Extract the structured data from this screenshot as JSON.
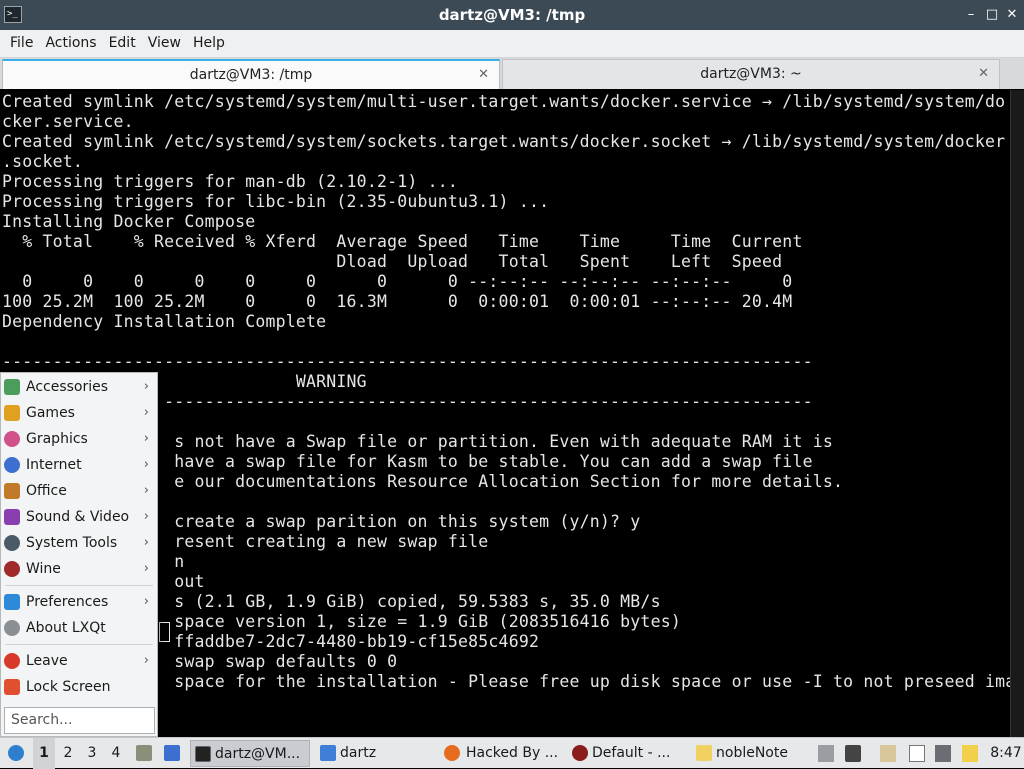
{
  "window": {
    "title": "dartz@VM3: /tmp",
    "app_icon_text": ">_",
    "minimize": "–",
    "maximize": "□",
    "close": "✕"
  },
  "menubar": [
    "File",
    "Actions",
    "Edit",
    "View",
    "Help"
  ],
  "tabs": [
    {
      "label": "dartz@VM3: /tmp",
      "close": "✕"
    },
    {
      "label": "dartz@VM3: ~",
      "close": "✕"
    }
  ],
  "terminal": {
    "lines": [
      "Created symlink /etc/systemd/system/multi-user.target.wants/docker.service → /lib/systemd/system/do",
      "cker.service.",
      "Created symlink /etc/systemd/system/sockets.target.wants/docker.socket → /lib/systemd/system/docker",
      ".socket.",
      "Processing triggers for man-db (2.10.2-1) ...",
      "Processing triggers for libc-bin (2.35-0ubuntu3.1) ...",
      "Installing Docker Compose",
      "  % Total    % Received % Xferd  Average Speed   Time    Time     Time  Current",
      "                                 Dload  Upload   Total   Spent    Left  Speed",
      "  0     0    0     0    0     0      0      0 --:--:-- --:--:-- --:--:--     0",
      "100 25.2M  100 25.2M    0     0  16.3M      0  0:00:01  0:00:01 --:--:-- 20.4M",
      "Dependency Installation Complete",
      "",
      "--------------------------------------------------------------------------------",
      "                             WARNING",
      "                ----------------------------------------------------------------",
      "",
      "                 s not have a Swap file or partition. Even with adequate RAM it is",
      "                 have a swap file for Kasm to be stable. You can add a swap file",
      "                 e our documentations Resource Allocation Section for more details.",
      "",
      "                 create a swap parition on this system (y/n)? y",
      "                 resent creating a new swap file",
      "                 n",
      "                 out",
      "                 s (2.1 GB, 1.9 GiB) copied, 59.5383 s, 35.0 MB/s",
      "                 space version 1, size = 1.9 GiB (2083516416 bytes)",
      "                 ffaddbe7-2dc7-4480-bb19-cf15e85c4692",
      "                 swap swap defaults 0 0",
      "                 space for the installation - Please free up disk space or use -I to not preseed ima",
      "",
      ""
    ]
  },
  "start_menu": {
    "items": [
      {
        "label": "Accessories",
        "icon": "accessories-icon",
        "submenu": true,
        "color": "#4a9d5b"
      },
      {
        "label": "Games",
        "icon": "games-icon",
        "submenu": true,
        "color": "#e0a020"
      },
      {
        "label": "Graphics",
        "icon": "graphics-icon",
        "submenu": true,
        "color": "#d0508a"
      },
      {
        "label": "Internet",
        "icon": "internet-icon",
        "submenu": true,
        "color": "#3c6fd0"
      },
      {
        "label": "Office",
        "icon": "office-icon",
        "submenu": true,
        "color": "#c07a2a"
      },
      {
        "label": "Sound & Video",
        "icon": "sound-video-icon",
        "submenu": true,
        "color": "#8a3fb0"
      },
      {
        "label": "System Tools",
        "icon": "system-tools-icon",
        "submenu": true,
        "color": "#4a5a66"
      },
      {
        "label": "Wine",
        "icon": "wine-icon",
        "submenu": true,
        "color": "#a02a2a"
      },
      {
        "label": "Preferences",
        "icon": "preferences-icon",
        "submenu": true,
        "color": "#2d8ad8"
      },
      {
        "label": "About LXQt",
        "icon": "about-icon",
        "submenu": false,
        "color": "#8a8f94"
      },
      {
        "label": "Leave",
        "icon": "leave-icon",
        "submenu": true,
        "color": "#d83a2a"
      },
      {
        "label": "Lock Screen",
        "icon": "lock-icon",
        "submenu": false,
        "color": "#e05030"
      }
    ],
    "arrow": "›",
    "search_placeholder": "Search..."
  },
  "taskbar": {
    "desktops": [
      "1",
      "2",
      "3",
      "4"
    ],
    "tasks": [
      {
        "label": "dartz@VM...",
        "icon": "terminal-icon"
      },
      {
        "label": "dartz",
        "icon": "folder-icon"
      },
      {
        "label": "Hacked By ...",
        "icon": "firefox-icon"
      },
      {
        "label": "Default - ...",
        "icon": "wine-glass-icon"
      },
      {
        "label": "nobleNote",
        "icon": "note-icon"
      }
    ],
    "clock": "8:47"
  }
}
